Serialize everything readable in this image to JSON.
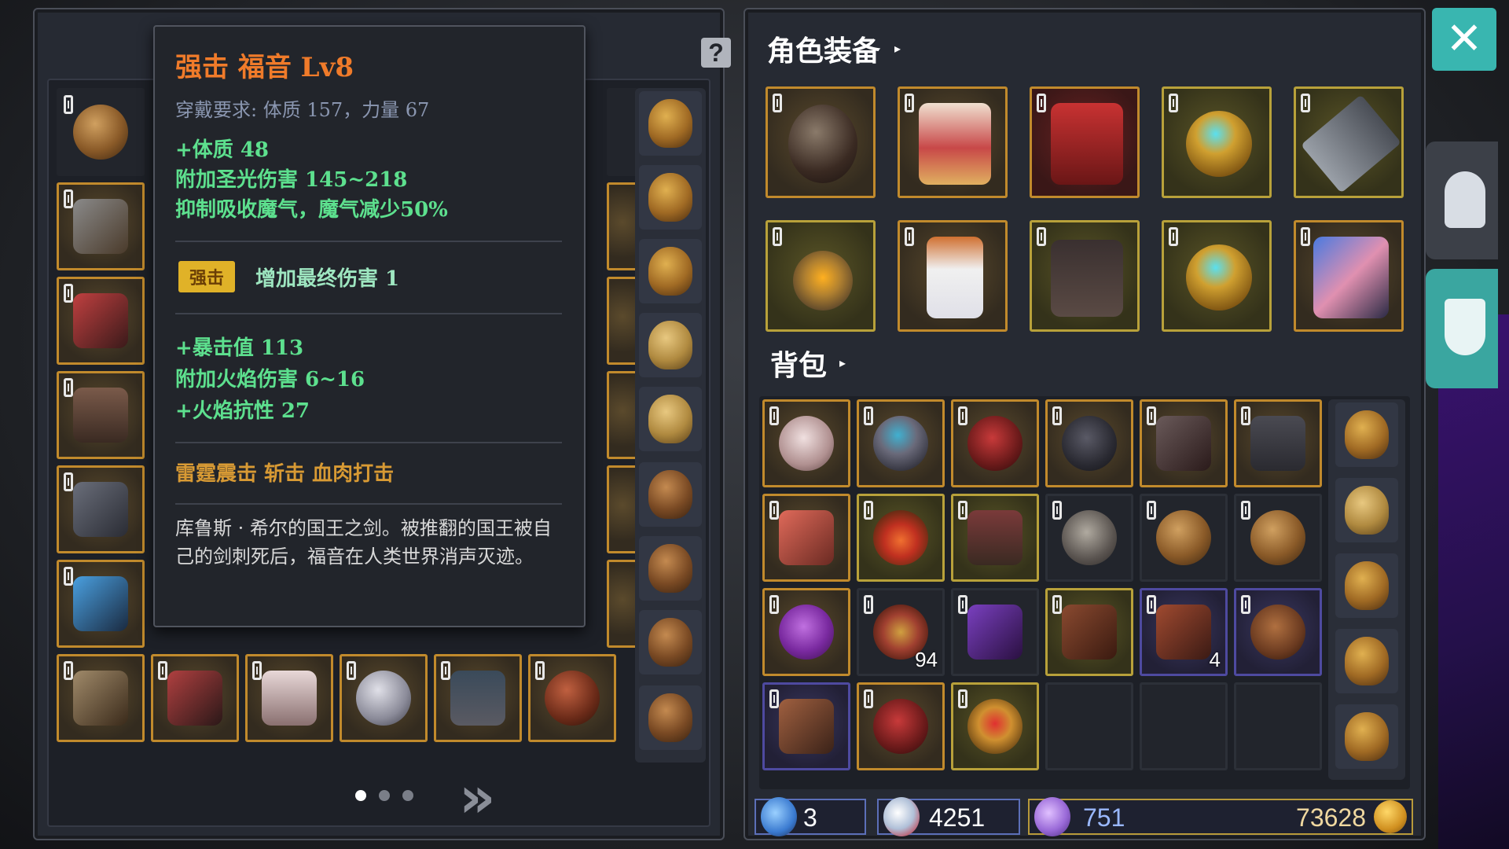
{
  "tooltip": {
    "title": "强击  福音  Lv8",
    "requirement": "穿戴要求:  体质 157，力量 67",
    "stats_a": [
      "+体质 48",
      "附加圣光伤害 145~218",
      "抑制吸收魔气，魔气减少50%"
    ],
    "badge": "强击",
    "badge_effect": "增加最终伤害 1",
    "stats_b": [
      "+暴击值 113",
      "附加火焰伤害 6~16",
      "+火焰抗性 27"
    ],
    "skills": "雷霆震击   斩击   血肉打击",
    "description": "库鲁斯 · 希尔的国王之剑。被推翻的国王被自己的剑刺死后，福音在人类世界消声灭迹。"
  },
  "left": {
    "help_label": "?",
    "next_label": "»",
    "page_indicator": {
      "pages": 3,
      "active": 1
    }
  },
  "equipment": {
    "title": "角色装备",
    "caret": "▸",
    "slots": [
      "helmet",
      "armor",
      "cloak",
      "ring",
      "sword",
      "amulet",
      "gloves",
      "boots",
      "ring",
      "shield"
    ]
  },
  "backpack": {
    "title": "背包",
    "caret": "▸",
    "quantities": {
      "swirl_stone": "94",
      "feather": "4"
    }
  },
  "resources": {
    "sword_count": "3",
    "crystal_count": "4251",
    "gem_count": "751",
    "gold": "73628"
  },
  "buttons": {
    "close": "✕"
  },
  "colors": {
    "accent": "#39b6b0",
    "item_border": "#c18a2c",
    "title_orange": "#f07b2a",
    "stat_green": "#5de08e"
  }
}
